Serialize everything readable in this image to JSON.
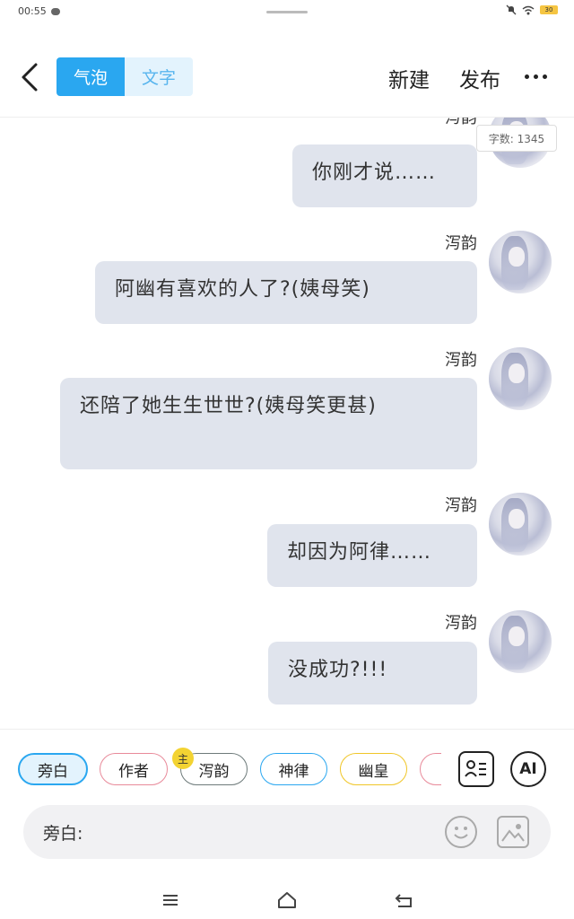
{
  "status": {
    "time": "00:55",
    "battery": "30"
  },
  "topbar": {
    "tab_bubble": "气泡",
    "tab_text": "文字",
    "new_label": "新建",
    "publish_label": "发布"
  },
  "word_count": "字数: 1345",
  "messages": [
    {
      "sender": "泻韵",
      "text": "你刚才说……"
    },
    {
      "sender": "泻韵",
      "text": "阿幽有喜欢的人了?(姨母笑)"
    },
    {
      "sender": "泻韵",
      "text": "还陪了她生生世世?(姨母笑更甚)"
    },
    {
      "sender": "泻韵",
      "text": "却因为阿律……"
    },
    {
      "sender": "泻韵",
      "text": "没成功?!!!"
    }
  ],
  "roles": [
    {
      "label": "旁白",
      "color": "#2aa7f0"
    },
    {
      "label": "作者",
      "color": "#e88a9a"
    },
    {
      "label": "泻韵",
      "color": "#6d7a7a"
    },
    {
      "label": "神律",
      "color": "#2aa7f0"
    },
    {
      "label": "幽皇",
      "color": "#f0c628"
    },
    {
      "label": "",
      "color": "#e88a9a"
    }
  ],
  "role_badge": "主",
  "ai_label": "AI",
  "input": {
    "label": "旁白:",
    "placeholder": ""
  },
  "colors": {
    "accent": "#2aa7f0",
    "bubble": "#e0e4ed"
  }
}
